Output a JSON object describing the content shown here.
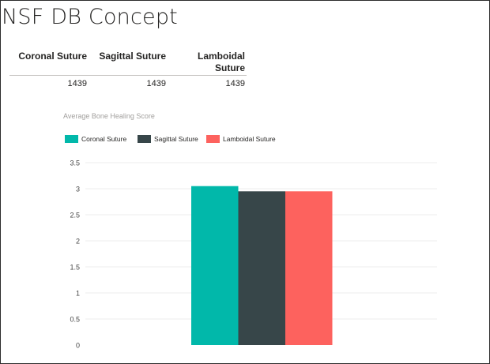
{
  "page": {
    "title": "NSF DB Concept"
  },
  "summary_table": {
    "headers": [
      "Coronal Suture",
      "Sagittal Suture",
      "Lamboidal Suture"
    ],
    "values": [
      "1439",
      "1439",
      "1439"
    ]
  },
  "chart_data": {
    "type": "bar",
    "title": "Average Bone Healing Score",
    "xlabel": "",
    "ylabel": "",
    "ylim": [
      0,
      3.5
    ],
    "y_ticks": [
      "3.5",
      "3",
      "2.5",
      "2",
      "1.5",
      "1",
      "0.5",
      "0"
    ],
    "legend_position": "top-left",
    "grid": true,
    "categories": [
      ""
    ],
    "series": [
      {
        "name": "Coronal Suture",
        "color": "#01b8aa",
        "values": [
          3.05
        ]
      },
      {
        "name": "Sagittal Suture",
        "color": "#374649",
        "values": [
          2.95
        ]
      },
      {
        "name": "Lamboidal Suture",
        "color": "#fd625e",
        "values": [
          2.95
        ]
      }
    ]
  }
}
